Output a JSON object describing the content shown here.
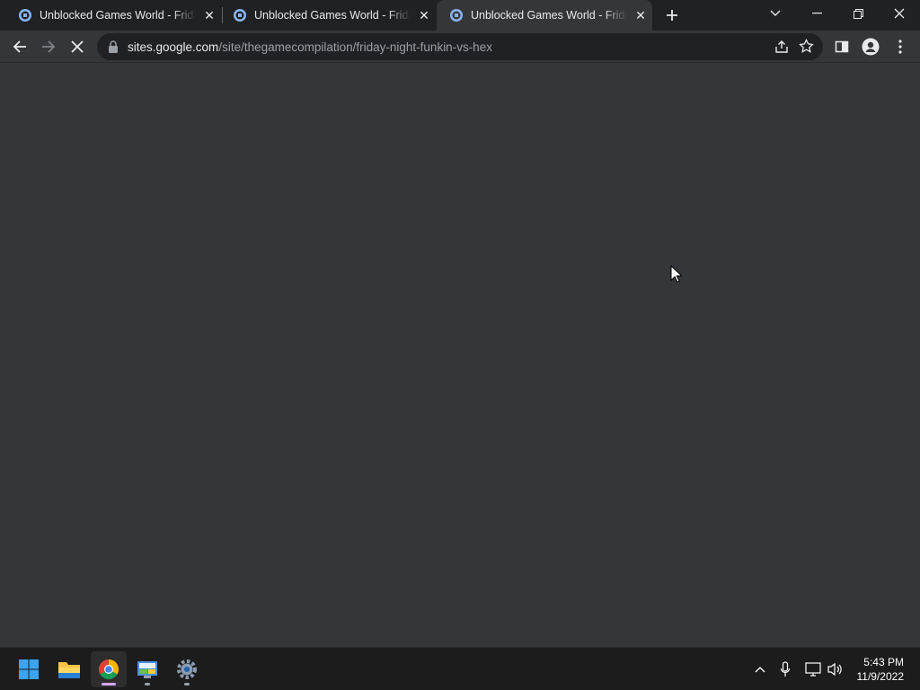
{
  "tabs": [
    {
      "title": "Unblocked Games World - Friday",
      "active": false
    },
    {
      "title": "Unblocked Games World - Friday",
      "active": false
    },
    {
      "title": "Unblocked Games World - Friday",
      "active": true
    }
  ],
  "toolbar": {
    "url_host": "sites.google.com",
    "url_path": "/site/thegamecompilation/friday-night-funkin-vs-hex"
  },
  "taskbar": {
    "apps": [
      "start-icon",
      "file-explorer-icon",
      "chrome-icon",
      "control-panel-icon",
      "settings-icon"
    ],
    "time": "5:43 PM",
    "date": "11/9/2022"
  },
  "colors": {
    "tab_active": "#35363a",
    "tabstrip": "#202124",
    "page_bg": "#35363a",
    "taskbar": "#1c1c1c"
  }
}
